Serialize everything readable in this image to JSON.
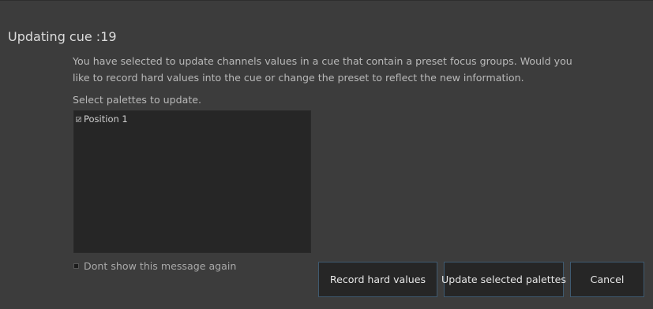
{
  "dialog": {
    "title": "Updating cue :19",
    "message": "You have selected to update channels values in a cue that contain a preset focus groups. Would you like to record hard values into the cue or change the preset to reflect the new information.",
    "select_label": "Select palettes to update.",
    "palettes": [
      {
        "label": "Position 1",
        "checked": true
      }
    ],
    "dont_show_label": "Dont show this message again",
    "dont_show_checked": false,
    "buttons": {
      "record": "Record hard values",
      "update": "Update selected palettes",
      "cancel": "Cancel"
    },
    "colors": {
      "background": "#3c3c3c",
      "list_background": "#262626",
      "button_border": "#3f5a70"
    }
  }
}
